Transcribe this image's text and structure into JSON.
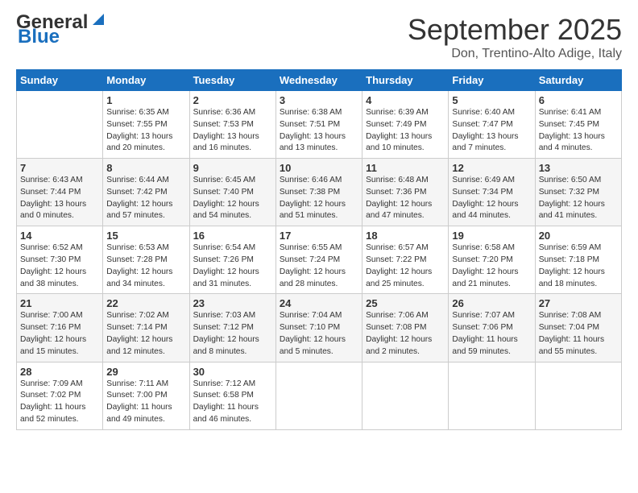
{
  "header": {
    "logo_general": "General",
    "logo_blue": "Blue",
    "month_title": "September 2025",
    "location": "Don, Trentino-Alto Adige, Italy"
  },
  "columns": [
    "Sunday",
    "Monday",
    "Tuesday",
    "Wednesday",
    "Thursday",
    "Friday",
    "Saturday"
  ],
  "weeks": [
    [
      {
        "day": "",
        "info": ""
      },
      {
        "day": "1",
        "info": "Sunrise: 6:35 AM\nSunset: 7:55 PM\nDaylight: 13 hours\nand 20 minutes."
      },
      {
        "day": "2",
        "info": "Sunrise: 6:36 AM\nSunset: 7:53 PM\nDaylight: 13 hours\nand 16 minutes."
      },
      {
        "day": "3",
        "info": "Sunrise: 6:38 AM\nSunset: 7:51 PM\nDaylight: 13 hours\nand 13 minutes."
      },
      {
        "day": "4",
        "info": "Sunrise: 6:39 AM\nSunset: 7:49 PM\nDaylight: 13 hours\nand 10 minutes."
      },
      {
        "day": "5",
        "info": "Sunrise: 6:40 AM\nSunset: 7:47 PM\nDaylight: 13 hours\nand 7 minutes."
      },
      {
        "day": "6",
        "info": "Sunrise: 6:41 AM\nSunset: 7:45 PM\nDaylight: 13 hours\nand 4 minutes."
      }
    ],
    [
      {
        "day": "7",
        "info": "Sunrise: 6:43 AM\nSunset: 7:44 PM\nDaylight: 13 hours\nand 0 minutes."
      },
      {
        "day": "8",
        "info": "Sunrise: 6:44 AM\nSunset: 7:42 PM\nDaylight: 12 hours\nand 57 minutes."
      },
      {
        "day": "9",
        "info": "Sunrise: 6:45 AM\nSunset: 7:40 PM\nDaylight: 12 hours\nand 54 minutes."
      },
      {
        "day": "10",
        "info": "Sunrise: 6:46 AM\nSunset: 7:38 PM\nDaylight: 12 hours\nand 51 minutes."
      },
      {
        "day": "11",
        "info": "Sunrise: 6:48 AM\nSunset: 7:36 PM\nDaylight: 12 hours\nand 47 minutes."
      },
      {
        "day": "12",
        "info": "Sunrise: 6:49 AM\nSunset: 7:34 PM\nDaylight: 12 hours\nand 44 minutes."
      },
      {
        "day": "13",
        "info": "Sunrise: 6:50 AM\nSunset: 7:32 PM\nDaylight: 12 hours\nand 41 minutes."
      }
    ],
    [
      {
        "day": "14",
        "info": "Sunrise: 6:52 AM\nSunset: 7:30 PM\nDaylight: 12 hours\nand 38 minutes."
      },
      {
        "day": "15",
        "info": "Sunrise: 6:53 AM\nSunset: 7:28 PM\nDaylight: 12 hours\nand 34 minutes."
      },
      {
        "day": "16",
        "info": "Sunrise: 6:54 AM\nSunset: 7:26 PM\nDaylight: 12 hours\nand 31 minutes."
      },
      {
        "day": "17",
        "info": "Sunrise: 6:55 AM\nSunset: 7:24 PM\nDaylight: 12 hours\nand 28 minutes."
      },
      {
        "day": "18",
        "info": "Sunrise: 6:57 AM\nSunset: 7:22 PM\nDaylight: 12 hours\nand 25 minutes."
      },
      {
        "day": "19",
        "info": "Sunrise: 6:58 AM\nSunset: 7:20 PM\nDaylight: 12 hours\nand 21 minutes."
      },
      {
        "day": "20",
        "info": "Sunrise: 6:59 AM\nSunset: 7:18 PM\nDaylight: 12 hours\nand 18 minutes."
      }
    ],
    [
      {
        "day": "21",
        "info": "Sunrise: 7:00 AM\nSunset: 7:16 PM\nDaylight: 12 hours\nand 15 minutes."
      },
      {
        "day": "22",
        "info": "Sunrise: 7:02 AM\nSunset: 7:14 PM\nDaylight: 12 hours\nand 12 minutes."
      },
      {
        "day": "23",
        "info": "Sunrise: 7:03 AM\nSunset: 7:12 PM\nDaylight: 12 hours\nand 8 minutes."
      },
      {
        "day": "24",
        "info": "Sunrise: 7:04 AM\nSunset: 7:10 PM\nDaylight: 12 hours\nand 5 minutes."
      },
      {
        "day": "25",
        "info": "Sunrise: 7:06 AM\nSunset: 7:08 PM\nDaylight: 12 hours\nand 2 minutes."
      },
      {
        "day": "26",
        "info": "Sunrise: 7:07 AM\nSunset: 7:06 PM\nDaylight: 11 hours\nand 59 minutes."
      },
      {
        "day": "27",
        "info": "Sunrise: 7:08 AM\nSunset: 7:04 PM\nDaylight: 11 hours\nand 55 minutes."
      }
    ],
    [
      {
        "day": "28",
        "info": "Sunrise: 7:09 AM\nSunset: 7:02 PM\nDaylight: 11 hours\nand 52 minutes."
      },
      {
        "day": "29",
        "info": "Sunrise: 7:11 AM\nSunset: 7:00 PM\nDaylight: 11 hours\nand 49 minutes."
      },
      {
        "day": "30",
        "info": "Sunrise: 7:12 AM\nSunset: 6:58 PM\nDaylight: 11 hours\nand 46 minutes."
      },
      {
        "day": "",
        "info": ""
      },
      {
        "day": "",
        "info": ""
      },
      {
        "day": "",
        "info": ""
      },
      {
        "day": "",
        "info": ""
      }
    ]
  ]
}
